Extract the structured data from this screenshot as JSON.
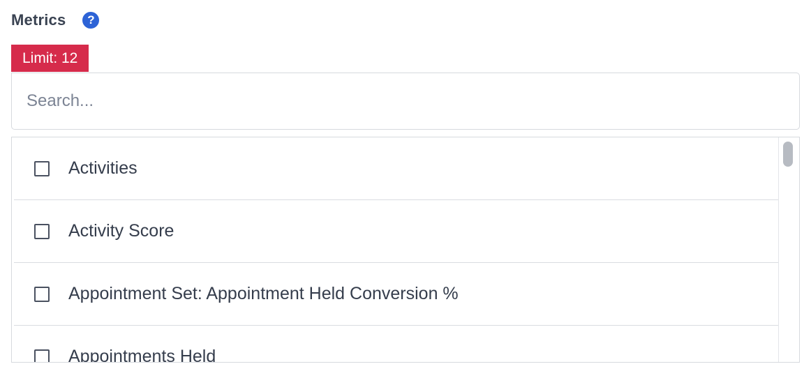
{
  "header": {
    "title": "Metrics",
    "help_icon": "question-circle-icon",
    "help_symbol": "?"
  },
  "limit_badge": {
    "label": "Limit: 12"
  },
  "search": {
    "placeholder": "Search...",
    "value": ""
  },
  "metrics": {
    "items": [
      {
        "label": "Activities",
        "checked": false
      },
      {
        "label": "Activity Score",
        "checked": false
      },
      {
        "label": "Appointment Set: Appointment Held Conversion %",
        "checked": false
      },
      {
        "label": "Appointments Held",
        "checked": false
      }
    ]
  },
  "colors": {
    "accent": "#2d63d6",
    "badge": "#d62b4b",
    "border": "#d6d9de",
    "text": "#2f3a4d"
  }
}
